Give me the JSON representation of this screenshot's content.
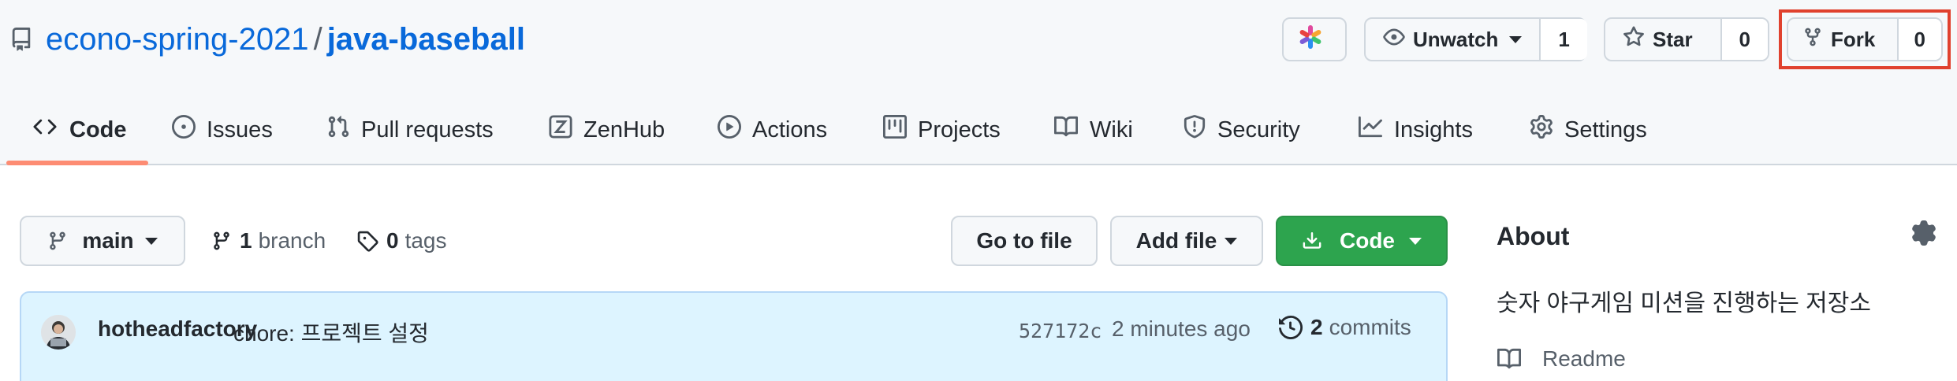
{
  "repo": {
    "owner": "econo-spring-2021",
    "separator": "/",
    "name": "java-baseball",
    "icon": "repo-icon"
  },
  "header_actions": {
    "app_icon": "zenhub-pinwheel-icon",
    "unwatch": {
      "label": "Unwatch",
      "count": "1",
      "icon": "eye-icon"
    },
    "star": {
      "label": "Star",
      "count": "0",
      "icon": "star-icon"
    },
    "fork": {
      "label": "Fork",
      "count": "0",
      "icon": "fork-icon",
      "highlighted": true,
      "highlight_color": "#e0412e"
    }
  },
  "tabs": [
    {
      "label": "Code",
      "icon": "code-icon",
      "active": true
    },
    {
      "label": "Issues",
      "icon": "issue-icon"
    },
    {
      "label": "Pull requests",
      "icon": "pull-request-icon"
    },
    {
      "label": "ZenHub",
      "icon": "zenhub-icon"
    },
    {
      "label": "Actions",
      "icon": "play-icon"
    },
    {
      "label": "Projects",
      "icon": "project-icon"
    },
    {
      "label": "Wiki",
      "icon": "book-icon"
    },
    {
      "label": "Security",
      "icon": "shield-icon"
    },
    {
      "label": "Insights",
      "icon": "graph-icon"
    },
    {
      "label": "Settings",
      "icon": "gear-icon"
    }
  ],
  "toolbar": {
    "branch_select": "main",
    "branch_count": "1",
    "branch_label": "branch",
    "tag_count": "0",
    "tag_label": "tags",
    "go_to_file": "Go to file",
    "add_file": "Add file",
    "code_button": "Code"
  },
  "commit": {
    "author": "hotheadfactory",
    "message": "chore: 프로젝트 설정",
    "sha": "527172c",
    "time": "2 minutes ago",
    "count": "2",
    "count_label": "commits"
  },
  "about": {
    "title": "About",
    "description": "숫자 야구게임 미션을 진행하는 저장소",
    "readme_label": "Readme"
  },
  "colors": {
    "link": "#0969da",
    "green_button": "#2da44e",
    "active_tab_underline": "#fd8c73",
    "commit_bar_bg": "#ddf4ff"
  }
}
